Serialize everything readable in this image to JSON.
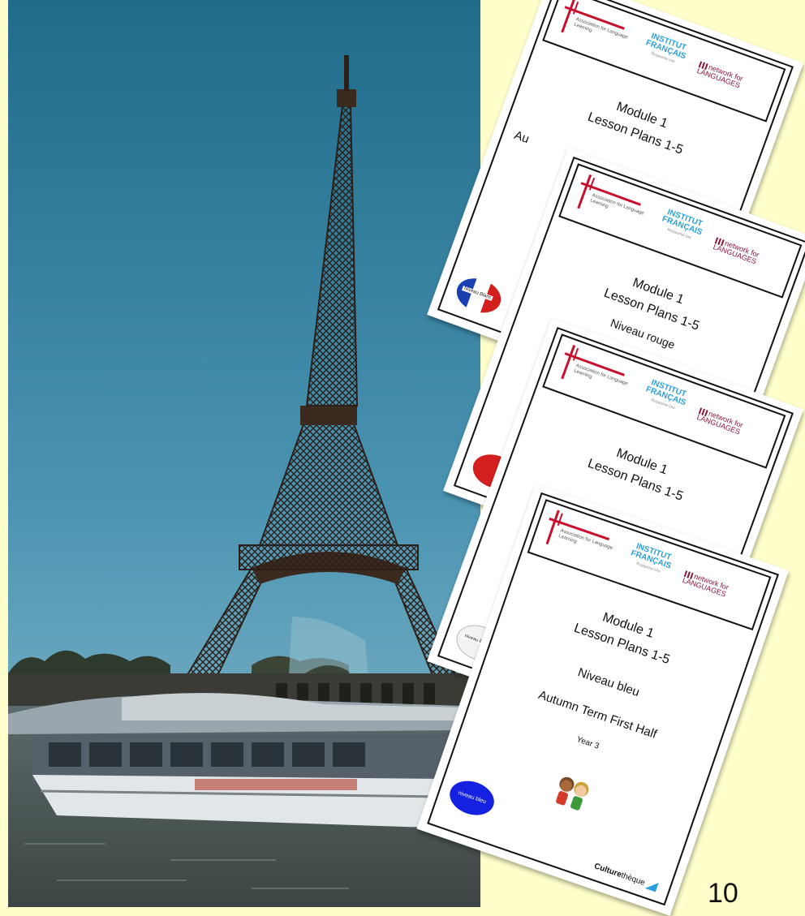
{
  "slide": {
    "page_number": "10",
    "background_color": "#ffffcc"
  },
  "photo": {
    "subject": "eiffel-tower-with-river-boat"
  },
  "documents": [
    {
      "header_logos": {
        "ali_text": "Association for Language Learning",
        "institut_line1": "INSTITUT",
        "institut_line2": "FRANÇAIS",
        "institut_sub": "Royaume-Uni",
        "network_line1": "network for",
        "network_line2": "LANGUAGES"
      },
      "module": "Module 1",
      "lessons": "Lesson Plans 1-5",
      "partial_text": "Au",
      "badge_text": "Niveau Blanc"
    },
    {
      "header_logos": {
        "ali_text": "Association for Language Learning",
        "institut_line1": "INSTITUT",
        "institut_line2": "FRANÇAIS",
        "institut_sub": "Royaume-Uni",
        "network_line1": "network for",
        "network_line2": "LANGUAGES"
      },
      "module": "Module 1",
      "lessons": "Lesson Plans 1-5",
      "partial_text": "Niveau rouge"
    },
    {
      "header_logos": {
        "ali_text": "Association for Language Learning",
        "institut_line1": "INSTITUT",
        "institut_line2": "FRANÇAIS",
        "institut_sub": "Royaume-Uni",
        "network_line1": "network for",
        "network_line2": "LANGUAGES"
      },
      "module": "Module 1",
      "lessons": "Lesson Plans 1-5",
      "badge_text": "niveau blanc"
    },
    {
      "header_logos": {
        "ali_text": "Association for Language Learning",
        "institut_line1": "INSTITUT",
        "institut_line2": "FRANÇAIS",
        "institut_sub": "Royaume-Uni",
        "network_line1": "network for",
        "network_line2": "LANGUAGES"
      },
      "module": "Module 1",
      "lessons": "Lesson Plans 1-5",
      "level": "Niveau bleu",
      "term": "Autumn Term First Half",
      "year": "Year 3",
      "badge_text": "niveau bleu",
      "footer_logo_bold": "Culture",
      "footer_logo_rest": "thèque"
    }
  ],
  "colors": {
    "badge_blue": "#1421e0",
    "logo_red": "#c8102e",
    "institut_blue": "#2a9fd8",
    "network_maroon": "#8a1538"
  }
}
